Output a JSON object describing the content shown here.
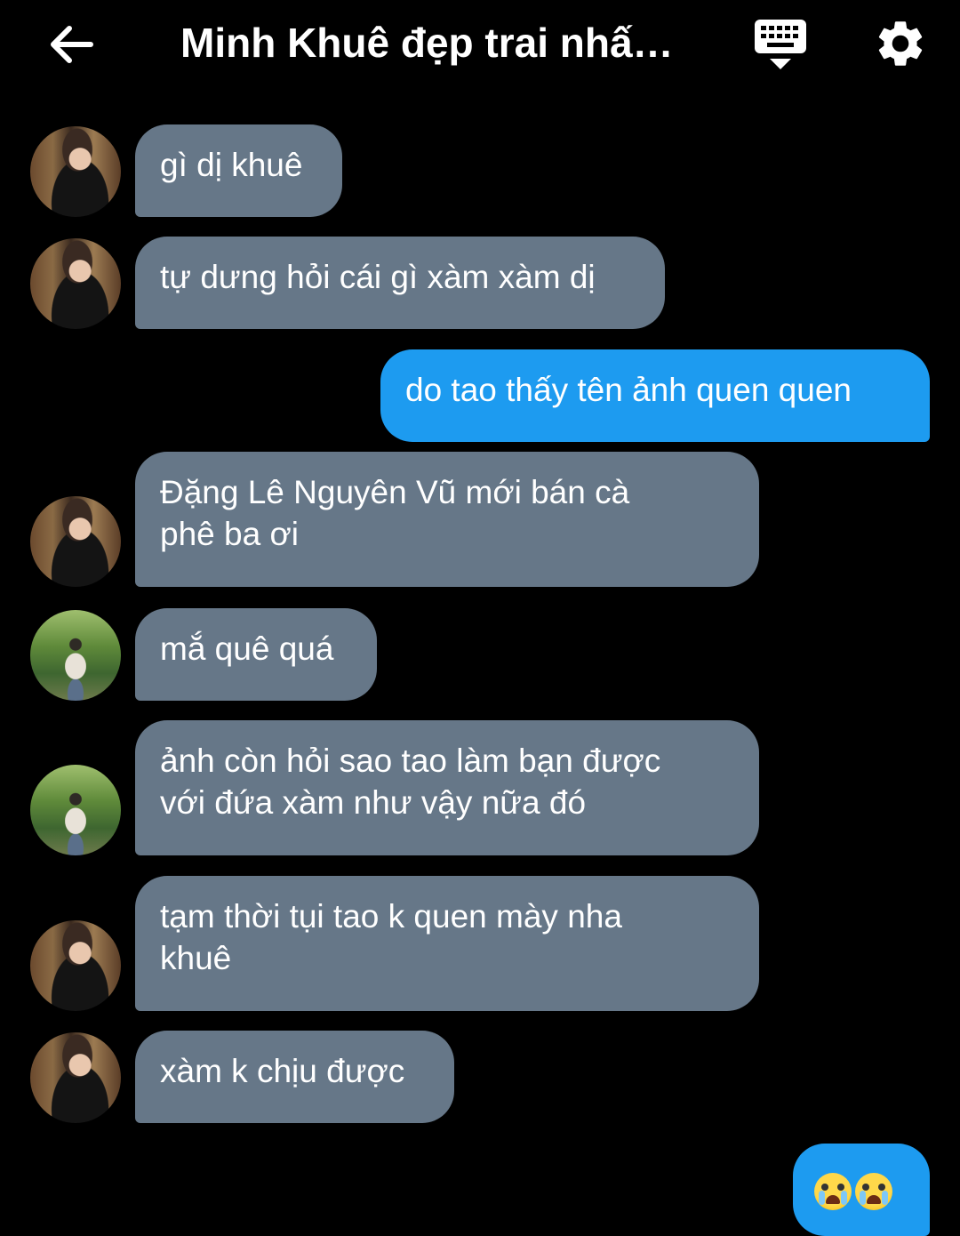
{
  "header": {
    "title": "Minh Khuê đẹp trai nhấ…",
    "back_icon": "arrow-left-icon",
    "keyboard_icon": "keyboard-hide-icon",
    "settings_icon": "gear-icon"
  },
  "colors": {
    "background": "#000000",
    "incoming_bubble": "#667788",
    "outgoing_bubble": "#1d9bf0"
  },
  "messages": [
    {
      "side": "in",
      "avatar": "avatar-portrait-indoor",
      "text": "gì dị khuê"
    },
    {
      "side": "in",
      "avatar": "avatar-portrait-indoor",
      "text": "tự dưng hỏi cái gì xàm xàm dị"
    },
    {
      "side": "out",
      "text": "do tao thấy tên ảnh quen quen"
    },
    {
      "side": "in",
      "avatar": "avatar-portrait-indoor",
      "line1": "Đặng Lê Nguyên Vũ mới bán cà",
      "line2": "phê ba ơi"
    },
    {
      "side": "in",
      "avatar": "avatar-portrait-outdoor",
      "text": "mắ quê quá"
    },
    {
      "side": "in",
      "avatar": "avatar-portrait-outdoor",
      "line1": "ảnh còn hỏi sao tao làm bạn được",
      "line2": "với đứa xàm như vậy nữa đó"
    },
    {
      "side": "in",
      "avatar": "avatar-portrait-indoor",
      "line1": "tạm thời tụi tao k quen mày nha",
      "line2": "khuê"
    },
    {
      "side": "in",
      "avatar": "avatar-portrait-indoor",
      "text": "xàm k chịu được"
    },
    {
      "side": "out",
      "emoji": "loudly-crying-face-icon x2"
    }
  ]
}
